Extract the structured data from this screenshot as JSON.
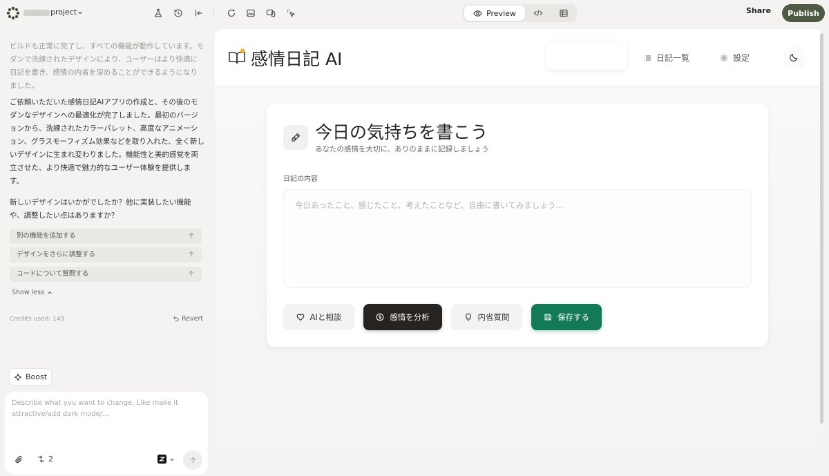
{
  "topbar": {
    "project_name": "project",
    "view_toggle": {
      "preview_label": "Preview"
    },
    "share_label": "Share",
    "publish_label": "Publish"
  },
  "chat": {
    "messages": [
      "ビルドも正常に完了し、すべての機能が動作しています。モダンで洗練されたデザインにより、ユーザーはより快適に日記を書き、感情の内省を深めることができるようになりました。",
      "ご依頼いただいた感情日記AIアプリの作成と、その後のモダンなデザインへの最適化が完了しました。最初のバージョンから、洗練されたカラーパレット、高度なアニメーション、グラスモーフィズム効果などを取り入れた、全く新しいデザインに生まれ変わりました。機能性と美的感覚を両立させた、より快適で魅力的なユーザー体験を提供します。",
      "新しいデザインはいかがでしたか？他に実装したい機能や、調整したい点はありますか？"
    ],
    "suggestions": [
      "別の機能を追加する",
      "デザインをさらに調整する",
      "コードについて質問する"
    ],
    "show_less_label": "Show less",
    "credits_label": "Credits used: 145",
    "revert_label": "Revert",
    "boost_label": "Boost",
    "composer": {
      "placeholder": "Describe what you want to change. Like make it attractive/add dark mode/...",
      "branch_count": "2"
    }
  },
  "app": {
    "brand_title": "感情日記 AI",
    "nav": {
      "list_label": "日記一覧",
      "settings_label": "設定"
    },
    "card": {
      "title": "今日の気持ちを書こう",
      "subtitle": "あなたの感情を大切に、ありのままに記録しましょう",
      "field_label": "日記の内容",
      "placeholder": "今日あったこと、感じたこと、考えたことなど、自由に書いてみましょう...",
      "buttons": {
        "consult": "AIと相談",
        "analyze": "感情を分析",
        "reflect": "内省質問",
        "save": "保存する"
      }
    }
  },
  "colors": {
    "publish": "#4e5a43",
    "save_button": "#147a55",
    "analyze_button": "#262321",
    "accent_dot": "#f0b429"
  }
}
